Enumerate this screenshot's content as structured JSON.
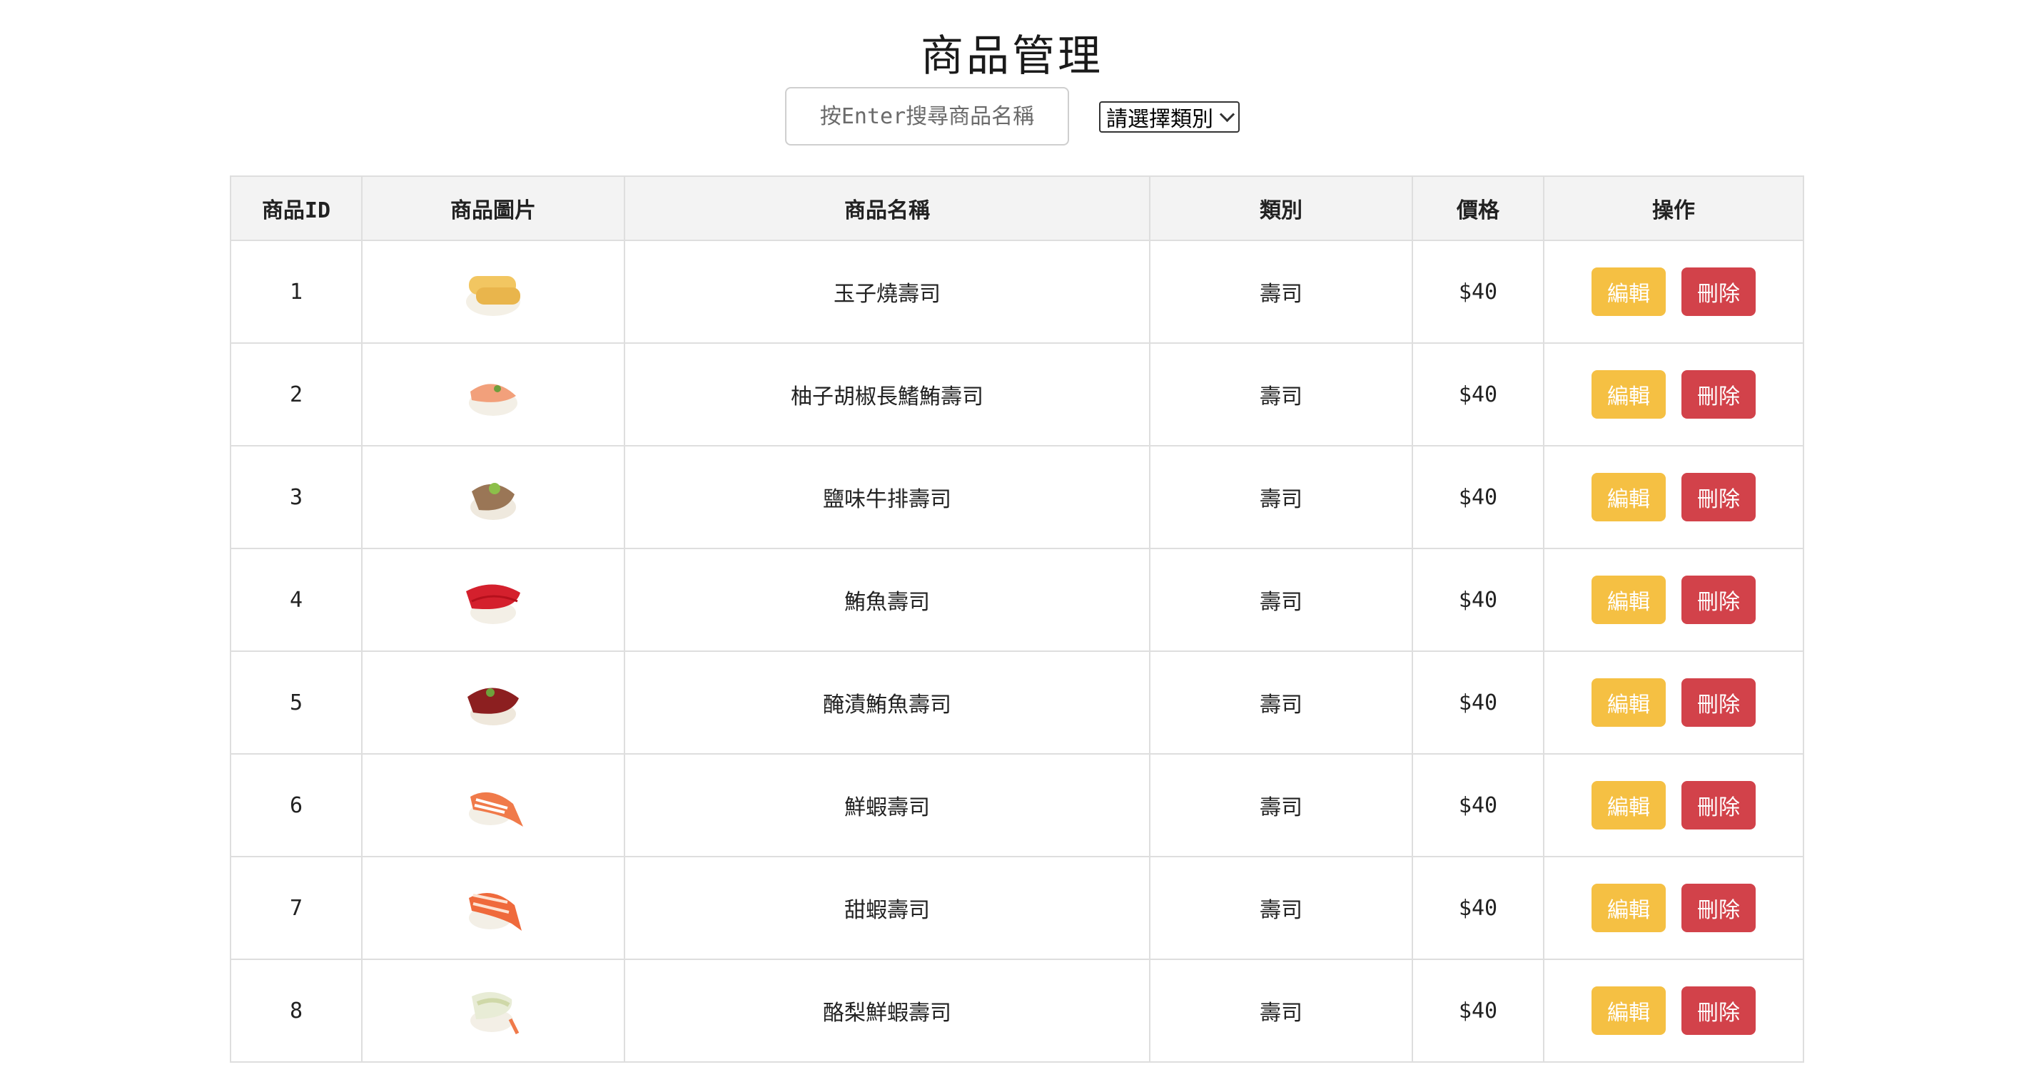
{
  "page": {
    "title": "商品管理",
    "search_placeholder": "按Enter搜尋商品名稱",
    "category_select": "請選擇類別"
  },
  "table": {
    "headers": [
      "商品ID",
      "商品圖片",
      "商品名稱",
      "類別",
      "價格",
      "操作"
    ],
    "rows": [
      {
        "id": "1",
        "name": "玉子燒壽司",
        "category": "壽司",
        "price": "$40",
        "image": "tamago-sushi"
      },
      {
        "id": "2",
        "name": "柚子胡椒長鰭鮪壽司",
        "category": "壽司",
        "price": "$40",
        "image": "albacore-sushi"
      },
      {
        "id": "3",
        "name": "鹽味牛排壽司",
        "category": "壽司",
        "price": "$40",
        "image": "beef-sushi"
      },
      {
        "id": "4",
        "name": "鮪魚壽司",
        "category": "壽司",
        "price": "$40",
        "image": "tuna-sushi"
      },
      {
        "id": "5",
        "name": "醃漬鮪魚壽司",
        "category": "壽司",
        "price": "$40",
        "image": "marinated-tuna-sushi"
      },
      {
        "id": "6",
        "name": "鮮蝦壽司",
        "category": "壽司",
        "price": "$40",
        "image": "shrimp-sushi"
      },
      {
        "id": "7",
        "name": "甜蝦壽司",
        "category": "壽司",
        "price": "$40",
        "image": "sweet-shrimp-sushi"
      },
      {
        "id": "8",
        "name": "酪梨鮮蝦壽司",
        "category": "壽司",
        "price": "$40",
        "image": "avocado-shrimp-sushi"
      }
    ],
    "edit_label": "編輯",
    "delete_label": "刪除"
  },
  "colors": {
    "edit": "#f5c043",
    "delete": "#d2424a",
    "header_bg": "#f3f3f3"
  }
}
